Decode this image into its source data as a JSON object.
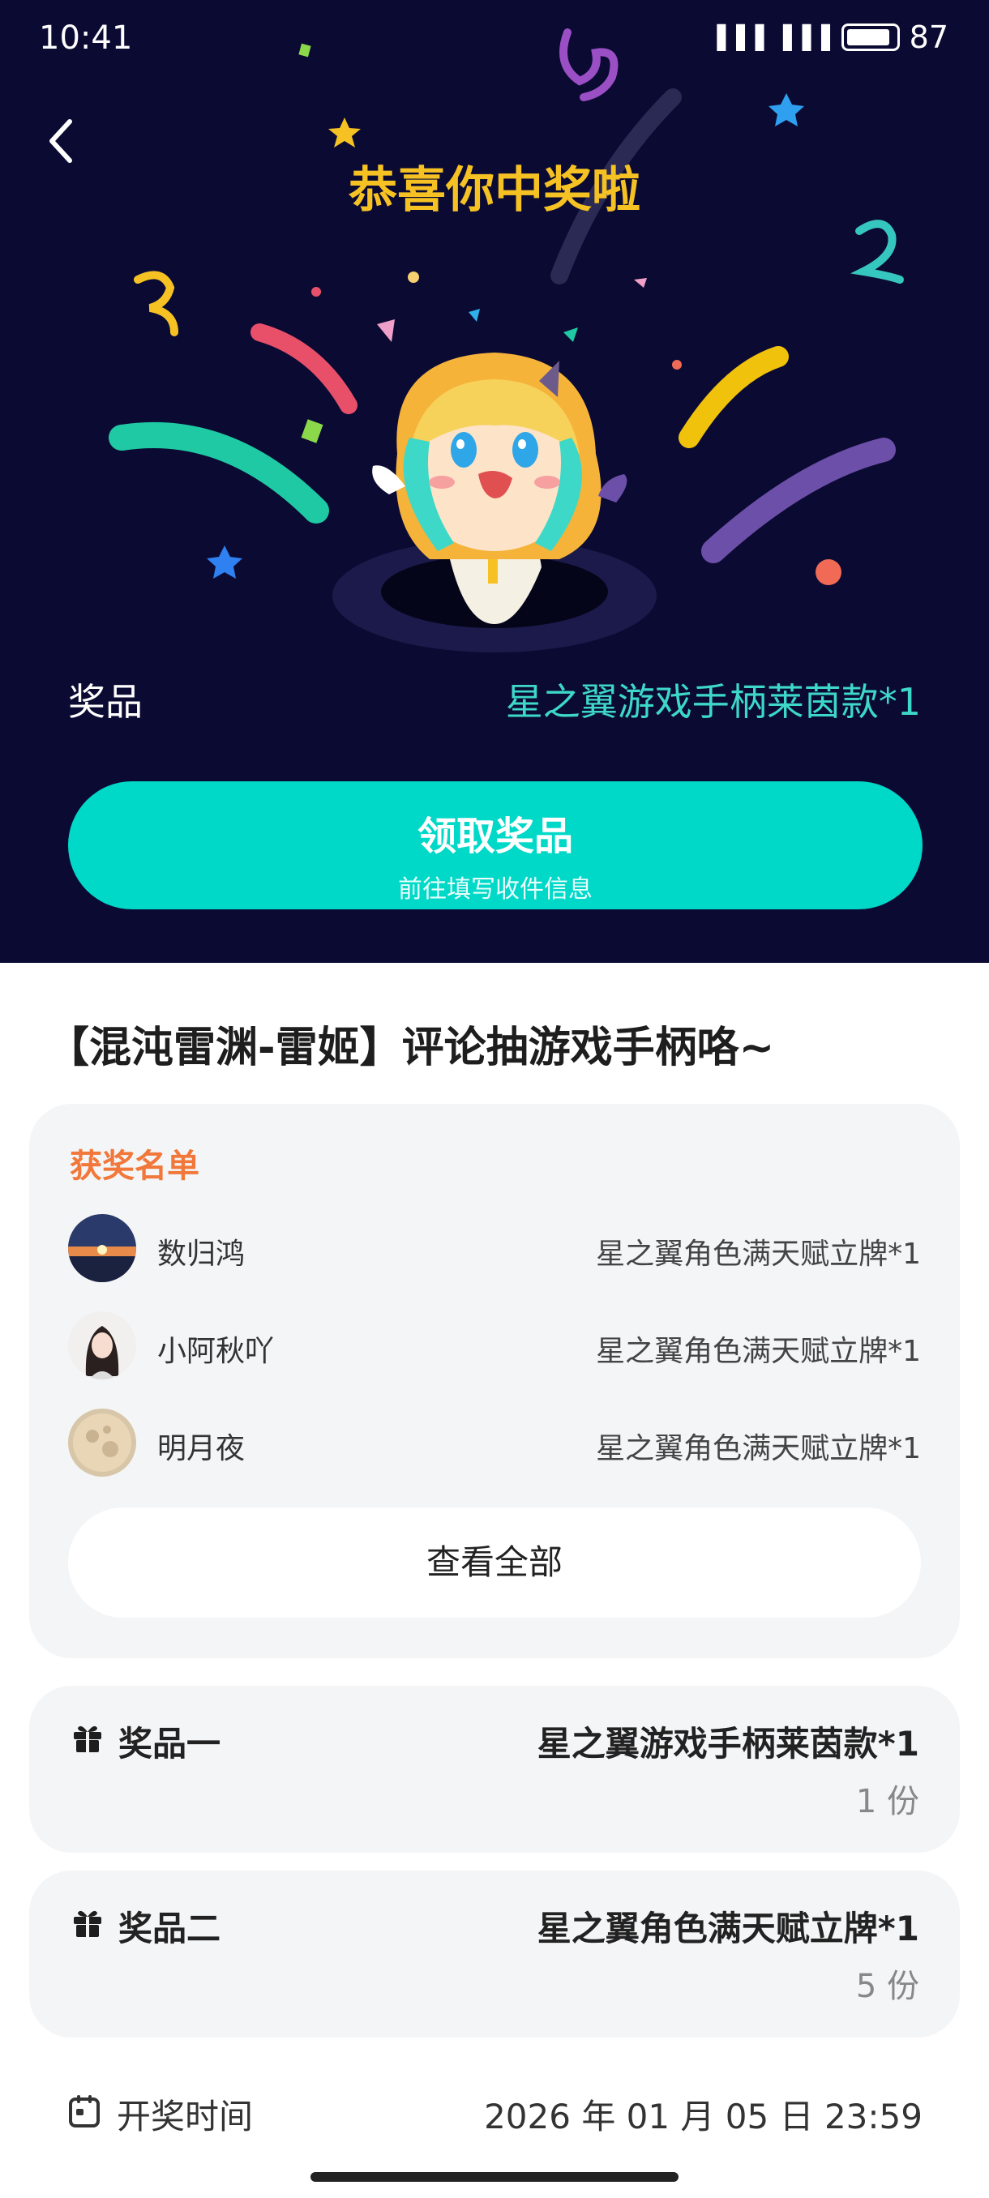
{
  "status_bar": {
    "time": "10:41",
    "battery": "87",
    "signal_text": "▐▐▐ ▐▐▐"
  },
  "header": {
    "back_icon": "chevron-left-icon",
    "title": "恭喜你中奖啦"
  },
  "prize": {
    "label": "奖品",
    "value": "星之翼游戏手柄莱茵款*1"
  },
  "claim_button": {
    "label": "领取奖品",
    "sublabel": "前往填写收件信息"
  },
  "activity": {
    "title": "【混沌雷渊-雷姬】评论抽游戏手柄咯~"
  },
  "winners": {
    "title": "获奖名单",
    "list": [
      {
        "name": "数归鸿",
        "prize": "星之翼角色满天赋立牌*1"
      },
      {
        "name": "小阿秋吖",
        "prize": "星之翼角色满天赋立牌*1"
      },
      {
        "name": "明月夜",
        "prize": "星之翼角色满天赋立牌*1"
      }
    ],
    "view_all_label": "查看全部"
  },
  "prizes": [
    {
      "name": "奖品一",
      "item": "星之翼游戏手柄莱茵款*1",
      "count": "1 份"
    },
    {
      "name": "奖品二",
      "item": "星之翼角色满天赋立牌*1",
      "count": "5 份"
    }
  ],
  "draw_time": {
    "label": "开奖时间",
    "value": "2026 年 01 月 05 日 23:59"
  },
  "colors": {
    "hero_bg": "#0b0a33",
    "title_yellow": "#f6c223",
    "accent_teal": "#00d8c8",
    "winners_title": "#f1783a"
  }
}
